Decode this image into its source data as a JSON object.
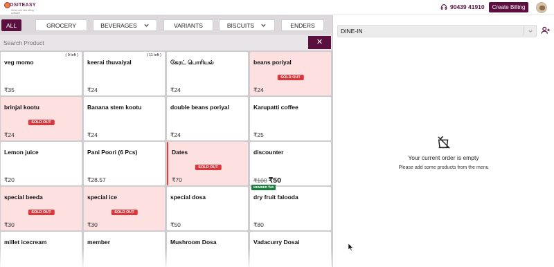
{
  "header": {
    "logo_brand": "OSITEASY",
    "logo_tagline": "Smart and fast billing software",
    "phone": "90439 41910",
    "billing_button": "Create Billing"
  },
  "categories": [
    {
      "label": "ALL",
      "active": true,
      "dropdown": false
    },
    {
      "label": "GROCERY",
      "active": false,
      "dropdown": false
    },
    {
      "label": "BEVERAGES",
      "active": false,
      "dropdown": true
    },
    {
      "label": "VARIANTS",
      "active": false,
      "dropdown": false
    },
    {
      "label": "BISCUITS",
      "active": false,
      "dropdown": true
    },
    {
      "label": "ENDERS",
      "active": false,
      "dropdown": false
    }
  ],
  "search": {
    "placeholder": "Search Product",
    "clear_icon": "close-icon"
  },
  "products": [
    {
      "name": "veg momo",
      "price": "₹35",
      "stock": "( 9 left )",
      "sold_out": false
    },
    {
      "name": "keerai thuvaiyal",
      "price": "₹24",
      "stock": "( 11 left )",
      "sold_out": false
    },
    {
      "name": "கேரட் பொரியல்",
      "price": "₹24",
      "stock": "",
      "sold_out": false
    },
    {
      "name": "beans poriyal",
      "price": "₹24",
      "stock": "",
      "sold_out": true
    },
    {
      "name": "brinjal kootu",
      "price": "₹24",
      "stock": "",
      "sold_out": true
    },
    {
      "name": "Banana stem kootu",
      "price": "₹24",
      "stock": "",
      "sold_out": false
    },
    {
      "name": "double beans poriyal",
      "price": "₹24",
      "stock": "",
      "sold_out": false
    },
    {
      "name": "Karupatti coffee",
      "price": "₹25",
      "stock": "",
      "sold_out": false
    },
    {
      "name": "Lemon juice",
      "price": "₹20",
      "stock": "",
      "sold_out": false
    },
    {
      "name": "Pani Poori (6 Pcs)",
      "price": "₹28.57",
      "stock": "",
      "sold_out": false
    },
    {
      "name": "Dates",
      "price": "₹70",
      "stock": "",
      "sold_out": true
    },
    {
      "name": "discounter",
      "price": "",
      "old_price": "₹100",
      "new_price": "₹50",
      "stock": "",
      "sold_out": false
    },
    {
      "name": "special beeda",
      "price": "₹30",
      "stock": "",
      "sold_out": true
    },
    {
      "name": "special ice",
      "price": "₹30",
      "stock": "",
      "sold_out": true
    },
    {
      "name": "special dosa",
      "price": "₹50",
      "stock": "",
      "sold_out": false
    },
    {
      "name": "dry fruit falooda",
      "price": "₹80",
      "stock": "",
      "sold_out": false,
      "member_badge": "MEMBER ₹60"
    },
    {
      "name": "millet icecream",
      "price": "",
      "stock": "",
      "sold_out": false
    },
    {
      "name": "member",
      "price": "",
      "stock": "",
      "sold_out": false
    },
    {
      "name": "Mushroom Dosa",
      "price": "",
      "stock": "",
      "sold_out": false
    },
    {
      "name": "Vadacurry Dosai",
      "price": "",
      "stock": "",
      "sold_out": false
    }
  ],
  "sold_out_label": "SOLD OUT",
  "order": {
    "order_type": "DINE-IN",
    "empty_title": "Your current order is empty",
    "empty_subtitle": "Please add some products from the menu"
  },
  "colors": {
    "brand": "#5a0f3e",
    "sold_out_bg": "#fde0e0",
    "sold_out_badge": "#d9383d",
    "member_badge": "#1e7c3e"
  }
}
